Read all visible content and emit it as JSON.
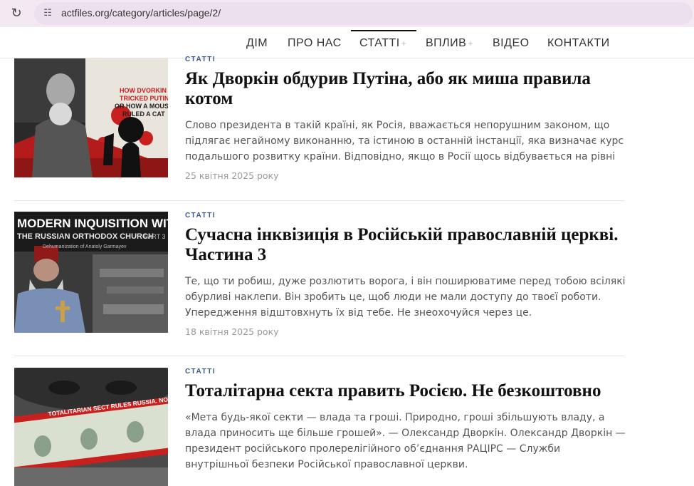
{
  "browser": {
    "url": "actfiles.org/category/articles/page/2/"
  },
  "nav": {
    "items": [
      {
        "label": "ДІМ",
        "has_plus": false
      },
      {
        "label": "ПРО НАС",
        "has_plus": false
      },
      {
        "label": "СТАТТІ",
        "has_plus": true,
        "active": true
      },
      {
        "label": "ВПЛИВ",
        "has_plus": true
      },
      {
        "label": "ВІДЕО",
        "has_plus": false
      },
      {
        "label": "КОНТАКТИ",
        "has_plus": false
      }
    ],
    "plus_sign": "+"
  },
  "articles": [
    {
      "category": "СТАТТІ",
      "title": "Як Дворкін обдурив Путіна, або як миша правила котом",
      "excerpt": "Слово президента в такій країні, як Росія, вважається непорушним законом, що підлягає негайному виконанню, та істиною в останній інстанції, яка визначає курс подальшого розвитку країни. Відповідно, якщо в Росії щось відбувається на рівні",
      "date": "25 квітня 2025 року",
      "image_text": [
        "HOW DVORKIN",
        "TRICKED PUTIN,",
        "OR HOW A MOUSE",
        "RULED A CAT"
      ]
    },
    {
      "category": "СТАТТІ",
      "title": "Сучасна інквізиція в Російській православній церкві. Частина 3",
      "excerpt": "Те, що ти робиш, дуже розлютить ворога, і він поширюватиме перед тобою всілякі обурливі наклепи. Він зробить це, щоб люди не мали доступу до твоєї роботи. Упередження відштовхнуть їх від тебе. Не знеохочуйся через це.",
      "date": "18 квітня 2025 року",
      "image_text": [
        "MODERN INQUISITION WITHIN",
        "THE RUSSIAN ORTHODOX CHURCH",
        "PART 3",
        "Dehumanization of Anatoly Garmayev"
      ]
    },
    {
      "category": "СТАТТІ",
      "title": "Тоталітарна секта править Росією. Не безкоштовно",
      "excerpt": "«Мета будь-якої секти — влада та гроші. Природно, гроші збільшують владу, а влада приносить ще більше грошей». — Олександр Дворкін. Олександр Дворкін — президент російського пролерелігійного об’єднання РАЦІРС — Служби внутрішньої безпеки Російської православної церкви.",
      "date": "",
      "image_text": [
        "TOTALITARIAN SECT RULES RUSSIA. NOT FOR FREE"
      ]
    }
  ],
  "colors": {
    "browser_bar": "#f2e9f3",
    "category": "#3a5a8c",
    "accent_red": "#c8201e"
  }
}
